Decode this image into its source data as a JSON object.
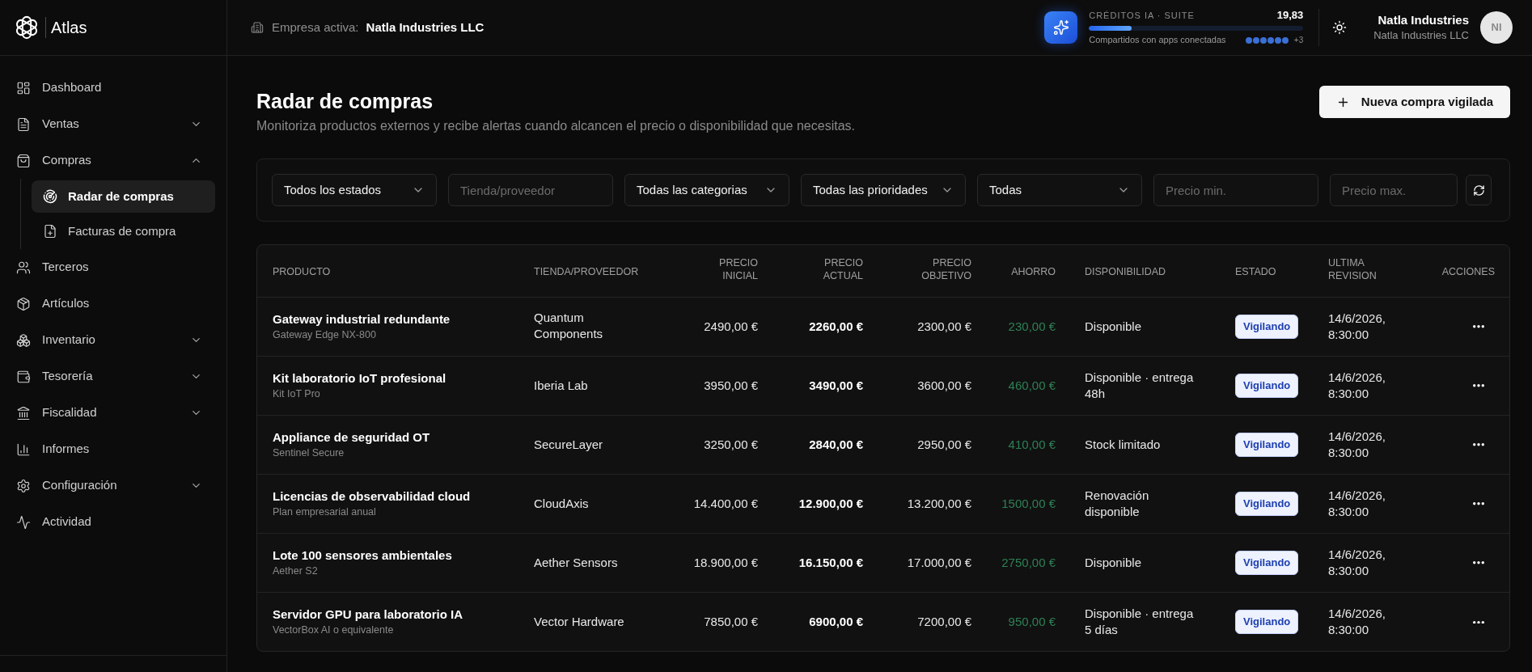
{
  "app": {
    "name": "Atlas"
  },
  "topbar": {
    "company_label": "Empresa activa:",
    "company": "Natla Industries LLC",
    "credits": {
      "title": "CRÉDITOS IA · SUITE",
      "amount": "19,83",
      "level": 0.2,
      "caption": "Compartidos con apps conectadas",
      "extra_apps": "+3"
    },
    "user": {
      "name": "Natla Industries",
      "company": "Natla Industries LLC",
      "initials": "NI"
    }
  },
  "sidebar": {
    "items": [
      {
        "label": "Dashboard",
        "kind": "link",
        "selected": false
      },
      {
        "label": "Ventas",
        "kind": "group",
        "expanded": false,
        "selected": false
      },
      {
        "label": "Compras",
        "kind": "group",
        "expanded": true,
        "selected": false,
        "children": [
          {
            "label": "Radar de compras",
            "selected": true
          },
          {
            "label": "Facturas de compra",
            "selected": false
          }
        ]
      },
      {
        "label": "Terceros",
        "kind": "link",
        "selected": false
      },
      {
        "label": "Artículos",
        "kind": "link",
        "selected": false
      },
      {
        "label": "Inventario",
        "kind": "group",
        "expanded": false,
        "selected": false
      },
      {
        "label": "Tesorería",
        "kind": "group",
        "expanded": false,
        "selected": false
      },
      {
        "label": "Fiscalidad",
        "kind": "group",
        "expanded": false,
        "selected": false
      },
      {
        "label": "Informes",
        "kind": "link",
        "selected": false
      },
      {
        "label": "Configuración",
        "kind": "group",
        "expanded": false,
        "selected": false
      },
      {
        "label": "Actividad",
        "kind": "link",
        "selected": false
      }
    ]
  },
  "page": {
    "title": "Radar de compras",
    "subtitle": "Monitoriza productos externos y recibe alertas cuando alcancen el precio o disponibilidad que necesitas.",
    "primary_button": "Nueva compra vigilada"
  },
  "filters": [
    {
      "kind": "select",
      "value": "Todos los estados"
    },
    {
      "kind": "input",
      "placeholder": "Tienda/proveedor"
    },
    {
      "kind": "select",
      "value": "Todas las categorias"
    },
    {
      "kind": "select",
      "value": "Todas las prioridades"
    },
    {
      "kind": "select",
      "value": "Todas"
    },
    {
      "kind": "input",
      "placeholder": "Precio min."
    },
    {
      "kind": "input",
      "placeholder": "Precio max."
    }
  ],
  "table": {
    "columns": [
      "PRODUCTO",
      "TIENDA/PROVEEDOR",
      "PRECIO INICIAL",
      "PRECIO ACTUAL",
      "PRECIO OBJETIVO",
      "AHORRO",
      "DISPONIBILIDAD",
      "ESTADO",
      "ULTIMA REVISION",
      "ACCIONES"
    ],
    "rows": [
      {
        "product": "Gateway industrial redundante",
        "model": "Gateway Edge NX-800",
        "store": "Quantum Components",
        "initial_price": "2490,00 €",
        "current_price": "2260,00 €",
        "target_price": "2300,00 €",
        "savings": "230,00 €",
        "availability": "Disponible",
        "status": "Vigilando",
        "last_revision": "14/6/2026, 8:30:00"
      },
      {
        "product": "Kit laboratorio IoT profesional",
        "model": "Kit IoT Pro",
        "store": "Iberia Lab",
        "initial_price": "3950,00 €",
        "current_price": "3490,00 €",
        "target_price": "3600,00 €",
        "savings": "460,00 €",
        "availability": "Disponible · entrega 48h",
        "status": "Vigilando",
        "last_revision": "14/6/2026, 8:30:00"
      },
      {
        "product": "Appliance de seguridad OT",
        "model": "Sentinel Secure",
        "store": "SecureLayer",
        "initial_price": "3250,00 €",
        "current_price": "2840,00 €",
        "target_price": "2950,00 €",
        "savings": "410,00 €",
        "availability": "Stock limitado",
        "status": "Vigilando",
        "last_revision": "14/6/2026, 8:30:00"
      },
      {
        "product": "Licencias de observabilidad cloud",
        "model": "Plan empresarial anual",
        "store": "CloudAxis",
        "initial_price": "14.400,00 €",
        "current_price": "12.900,00 €",
        "target_price": "13.200,00 €",
        "savings": "1500,00 €",
        "availability": "Renovación disponible",
        "status": "Vigilando",
        "last_revision": "14/6/2026, 8:30:00"
      },
      {
        "product": "Lote 100 sensores ambientales",
        "model": "Aether S2",
        "store": "Aether Sensors",
        "initial_price": "18.900,00 €",
        "current_price": "16.150,00 €",
        "target_price": "17.000,00 €",
        "savings": "2750,00 €",
        "availability": "Disponible",
        "status": "Vigilando",
        "last_revision": "14/6/2026, 8:30:00"
      },
      {
        "product": "Servidor GPU para laboratorio IA",
        "model": "VectorBox AI o equivalente",
        "store": "Vector Hardware",
        "initial_price": "7850,00 €",
        "current_price": "6900,00 €",
        "target_price": "7200,00 €",
        "savings": "950,00 €",
        "availability": "Disponible · entrega 5 días",
        "status": "Vigilando",
        "last_revision": "14/6/2026, 8:30:00"
      }
    ]
  }
}
